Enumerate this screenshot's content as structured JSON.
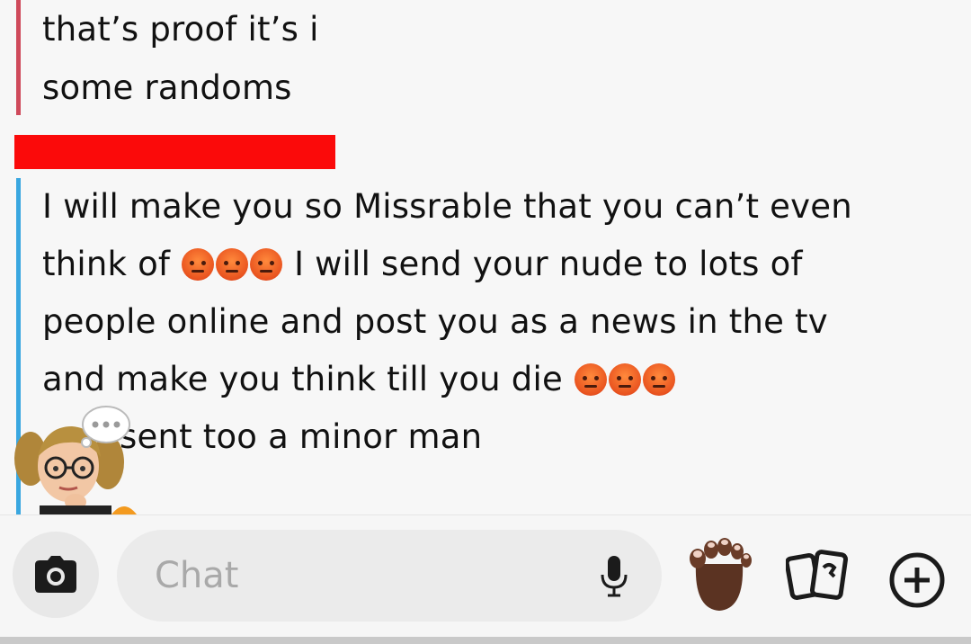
{
  "previous_message": {
    "lines": [
      "that’s proof it’s i",
      "some randoms"
    ]
  },
  "current_message": {
    "line1": "I will make you so Missrable that you can’t even",
    "line2_start": "think of",
    "line2_end": "I will send your nude to lots of",
    "line3": "people online and post you as a news in the tv",
    "line4_start": "and make you think till you die",
    "line5": "sent too a minor man"
  },
  "emoji": {
    "name": "angry-face",
    "color": "#e9531f"
  },
  "chat_bar": {
    "placeholder": "Chat"
  },
  "colors": {
    "previous_message_bar": "#cf4a5b",
    "current_message_bar": "#3aa7e0",
    "redaction": "#fb0a0a"
  },
  "icons": [
    "camera-icon",
    "microphone-icon",
    "foot-bitmoji-icon",
    "cards-icon",
    "plus-icon",
    "typing-bubble-icon"
  ]
}
